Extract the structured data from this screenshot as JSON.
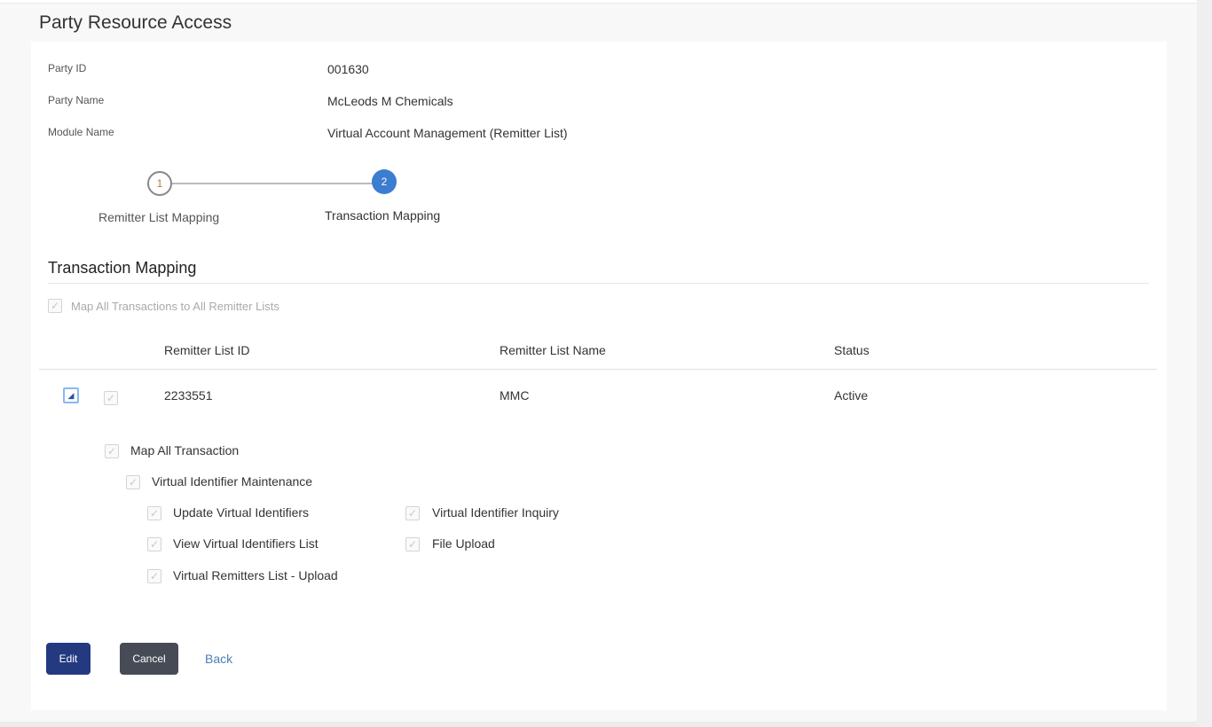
{
  "page_title": "Party Resource Access",
  "details": [
    {
      "label": "Party ID",
      "value": "001630"
    },
    {
      "label": "Party Name",
      "value": "McLeods M Chemicals"
    },
    {
      "label": "Module Name",
      "value": "Virtual Account Management (Remitter List)"
    }
  ],
  "steps": [
    {
      "number": "1",
      "label": "Remitter List Mapping"
    },
    {
      "number": "2",
      "label": "Transaction Mapping"
    }
  ],
  "section_title": "Transaction Mapping",
  "map_all_label": "Map All Transactions to All Remitter Lists",
  "table": {
    "headers": [
      "Remitter List ID",
      "Remitter List Name",
      "Status"
    ],
    "rows": [
      {
        "id": "2233551",
        "name": "MMC",
        "status": "Active"
      }
    ]
  },
  "transactions": {
    "map_all": "Map All Transaction",
    "group": "Virtual Identifier Maintenance",
    "items": [
      "Update Virtual Identifiers",
      "Virtual Identifier Inquiry",
      "View Virtual Identifiers List",
      "File Upload",
      "Virtual Remitters List - Upload"
    ]
  },
  "buttons": {
    "edit": "Edit",
    "cancel": "Cancel",
    "back": "Back"
  },
  "colors": {
    "primary": "#233a80",
    "secondary": "#474b55",
    "step_active": "#3b7dd0",
    "link": "#4a7fb8"
  }
}
